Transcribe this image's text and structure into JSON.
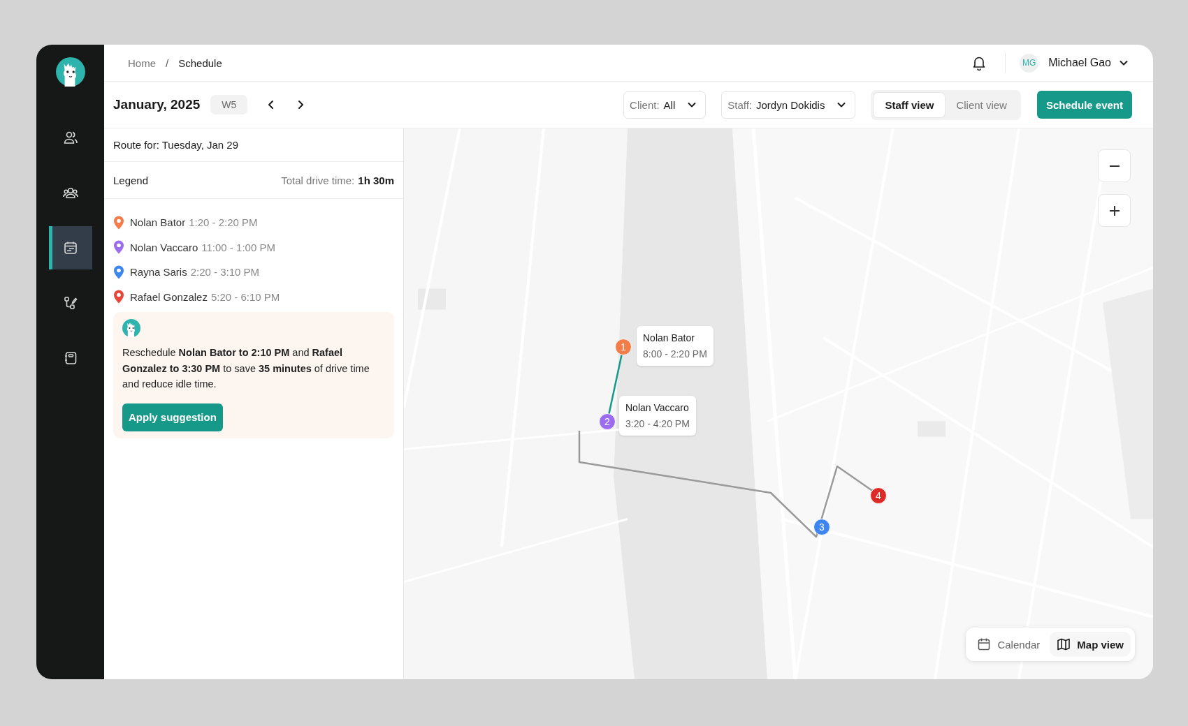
{
  "sidebar": {
    "items": [
      {
        "kind": "person",
        "selected": false
      },
      {
        "kind": "group",
        "selected": false
      },
      {
        "kind": "calendar",
        "selected": true
      },
      {
        "kind": "flow",
        "selected": false
      },
      {
        "kind": "notebook",
        "selected": false
      }
    ]
  },
  "breadcrumb": [
    "Home",
    "Schedule"
  ],
  "breadcrumb_separator": "/",
  "user": {
    "initials": "MG",
    "name": "Michael Gao"
  },
  "toolbar": {
    "month": "January, 2025",
    "week": "W5",
    "client_filter": {
      "label": "Client:",
      "value": "All"
    },
    "staff_filter": {
      "label": "Staff:",
      "value": "Jordyn Dokidis"
    },
    "views": [
      {
        "label": "Staff view",
        "selected": true
      },
      {
        "label": "Client view",
        "selected": false
      }
    ],
    "action": "Schedule event"
  },
  "route": {
    "title": "Route for: Tuesday, Jan 29",
    "legend_title": "Legend",
    "drive_time_label": "Total drive time:",
    "drive_time": "1h 30m",
    "stops": [
      {
        "name": "Nolan Bator",
        "time": "1:20 - 2:20 PM",
        "color": "#f47c48"
      },
      {
        "name": "Nolan Vaccaro",
        "time": "11:00 - 1:00 PM",
        "color": "#9b6cf0"
      },
      {
        "name": "Rayna Saris",
        "time": "2:20 - 3:10 PM",
        "color": "#3d85f0"
      },
      {
        "name": "Rafael Gonzalez",
        "time": "5:20 - 6:10 PM",
        "color": "#e8463a"
      }
    ]
  },
  "suggestion": {
    "text": "Reschedule **Nolan Bator to 2:10 PM** and **Rafael Gonzalez to 3:30 PM** to save **35 minutes** of drive time and reduce idle time.",
    "action": "Apply suggestion"
  },
  "map": {
    "markers": [
      {
        "number": "1",
        "color": "#f47c48"
      },
      {
        "number": "2",
        "color": "#9b6cf0"
      },
      {
        "number": "3",
        "color": "#3d85f0"
      },
      {
        "number": "4",
        "color": "#de2a26"
      }
    ],
    "popups": [
      {
        "name": "Nolan Bator",
        "time": "8:00 - 2:20 PM"
      },
      {
        "name": "Nolan Vaccaro",
        "time": "3:20 - 4:20 PM"
      }
    ],
    "modes": [
      {
        "label": "Calendar",
        "kind": "calendar",
        "selected": false
      },
      {
        "label": "Map view",
        "kind": "map",
        "selected": true
      }
    ]
  }
}
